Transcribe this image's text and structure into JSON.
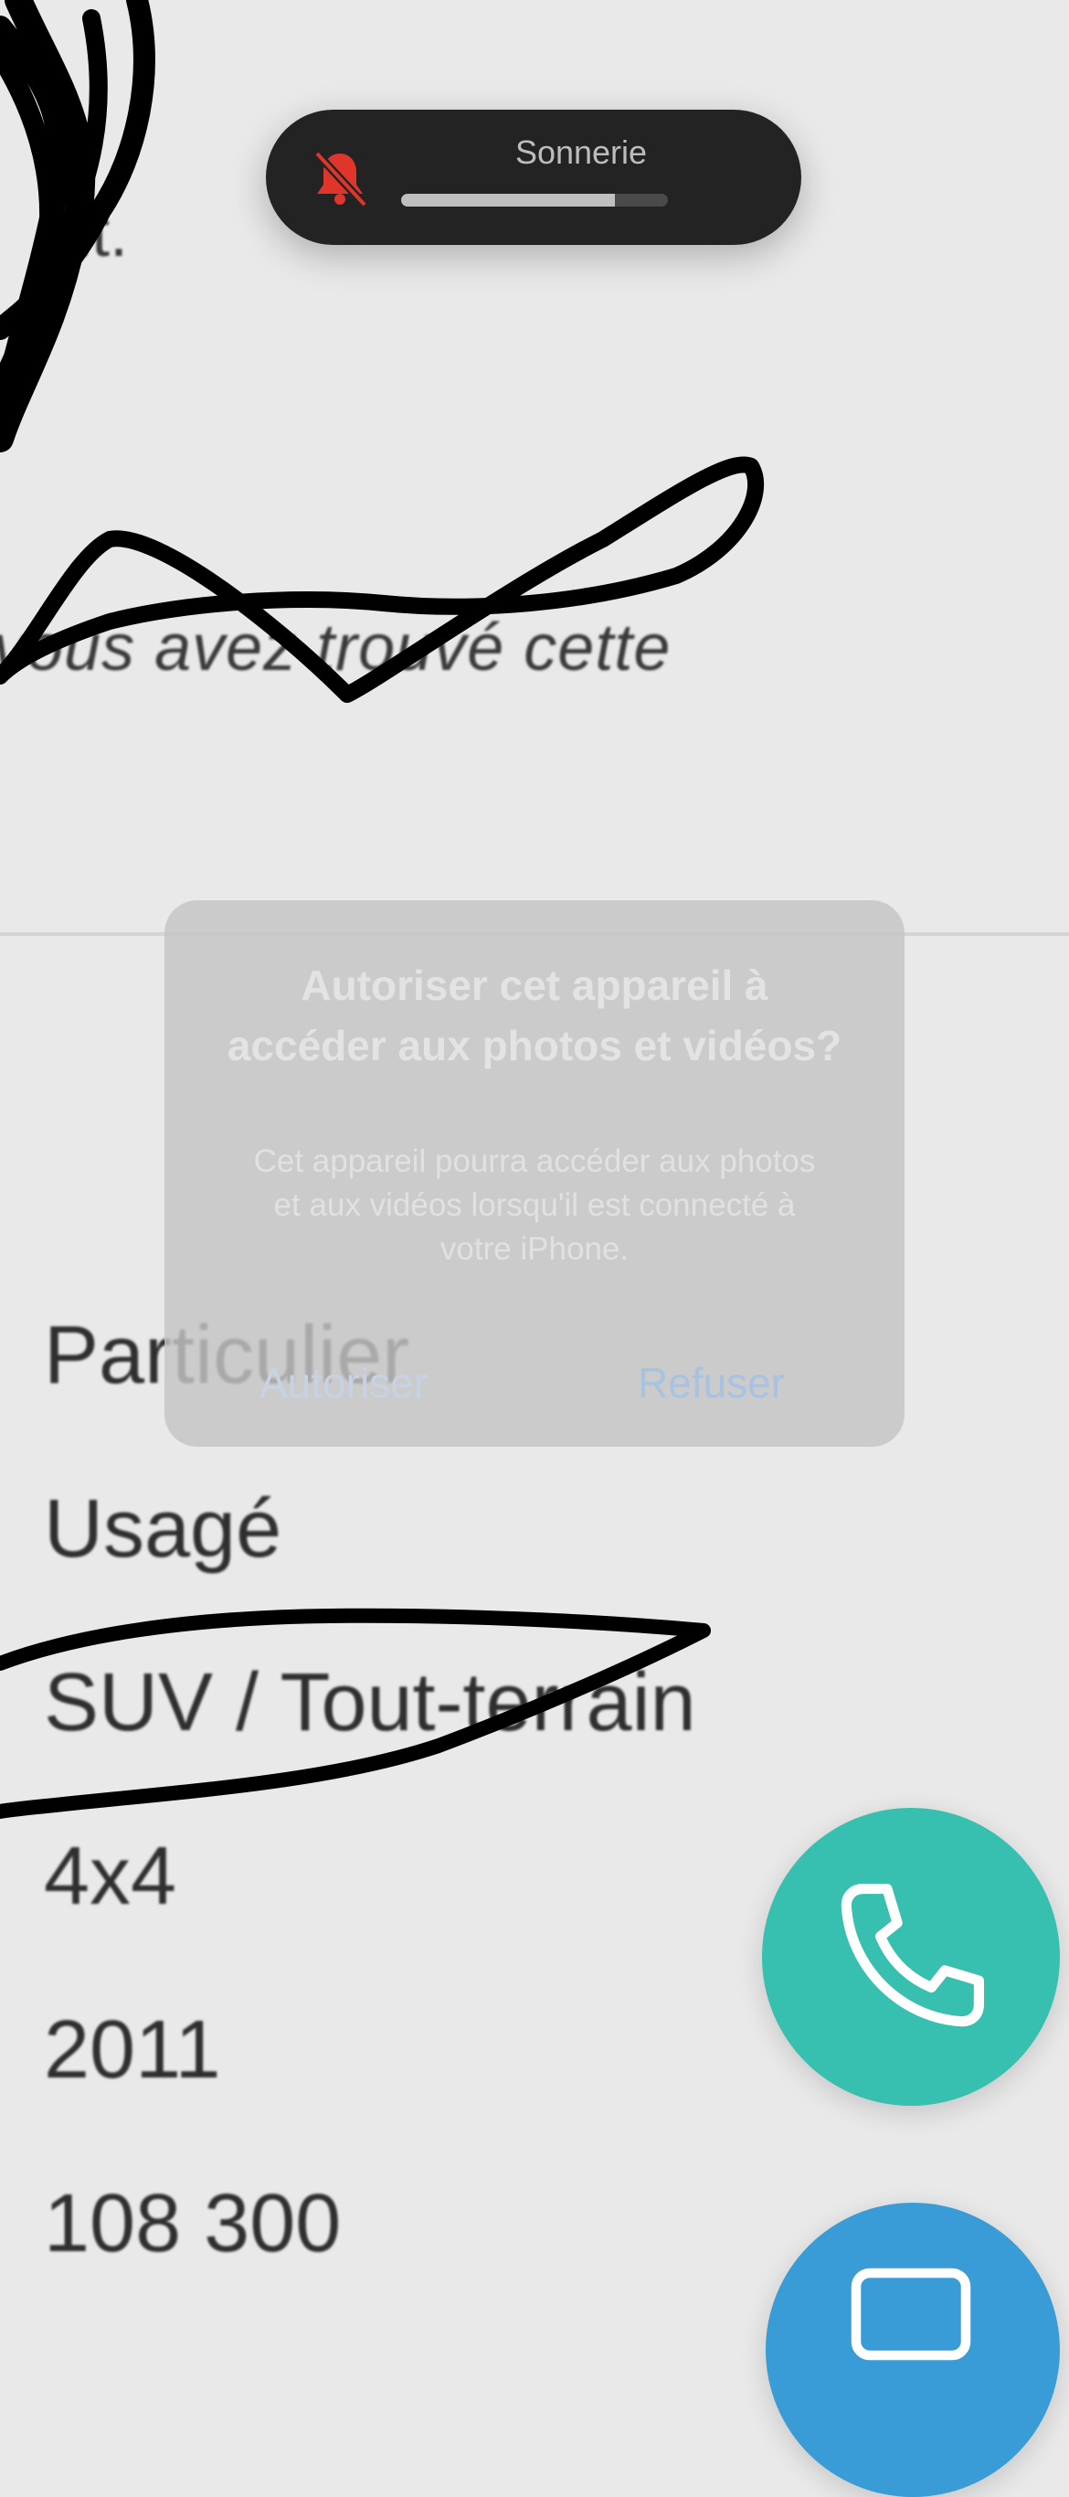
{
  "background_fragments": {
    "top": "nt.",
    "middle": "vous avez trouvé cette"
  },
  "specs": [
    "Particulier",
    "Usagé",
    "SUV / Tout-terrain",
    "4x4",
    "2011",
    "108 300"
  ],
  "ringer": {
    "label": "Sonnerie",
    "level": 0.8,
    "icon": "bell-slash-icon",
    "icon_color": "#e0352b"
  },
  "alert": {
    "title": "Autoriser cet appareil à accéder aux photos et vidéos?",
    "message": "Cet appareil pourra accéder aux photos et aux vidéos lorsqu'il est connecté à votre iPhone.",
    "allow_label": "Autoriser",
    "deny_label": "Refuser"
  },
  "fabs": {
    "call_icon": "phone-icon",
    "call_color": "#37bfaf",
    "message_icon": "message-icon",
    "message_color": "#3a9cd6"
  }
}
